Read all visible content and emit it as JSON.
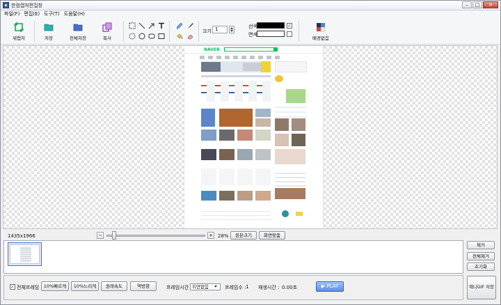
{
  "window": {
    "title": "한컴캡처편집창",
    "min": "–",
    "max": "□",
    "close": "✕"
  },
  "menu": [
    "파일(F)",
    "편집(E)",
    "도구(T)",
    "도움말(H)"
  ],
  "toolbar": {
    "new_capture": "새캡처",
    "save": "저장",
    "save_all": "전체저장",
    "copy": "복사",
    "size_label": "크기",
    "size_value": "1",
    "line_label": "선색",
    "fill_label": "면색",
    "line_color": "#000000",
    "fill_color": "#ffffff",
    "line_checked": "✓",
    "fill_checked": "",
    "bg_remove": "배경없음"
  },
  "status": {
    "dimensions": "1435x1966",
    "zoom": "28%"
  },
  "view_buttons": {
    "original": "원본크기",
    "fit": "화면맞춤"
  },
  "side_buttons": {
    "remove": "제거",
    "remove_all": "전체제거",
    "reset": "초기화"
  },
  "options": {
    "all_frames": "전체프레임",
    "faster": "10%빠르게",
    "slower": "10%느리게",
    "reverse": "원래속도",
    "reverse2": "역방향",
    "frame_time_label": "프레임시간",
    "frame_time_value": "지연없음",
    "frame_count_label": "프레임수 :",
    "frame_count": "1",
    "play_time_label": "재생시간 :",
    "play_time": "0.00초",
    "play": "▶ PLAY",
    "save_anim": "애니GIF 저장"
  },
  "page_preview": {
    "logo": "NAVER"
  },
  "colors": {
    "accent_green": "#03c75a",
    "play_blue": "#5d8fe4"
  }
}
